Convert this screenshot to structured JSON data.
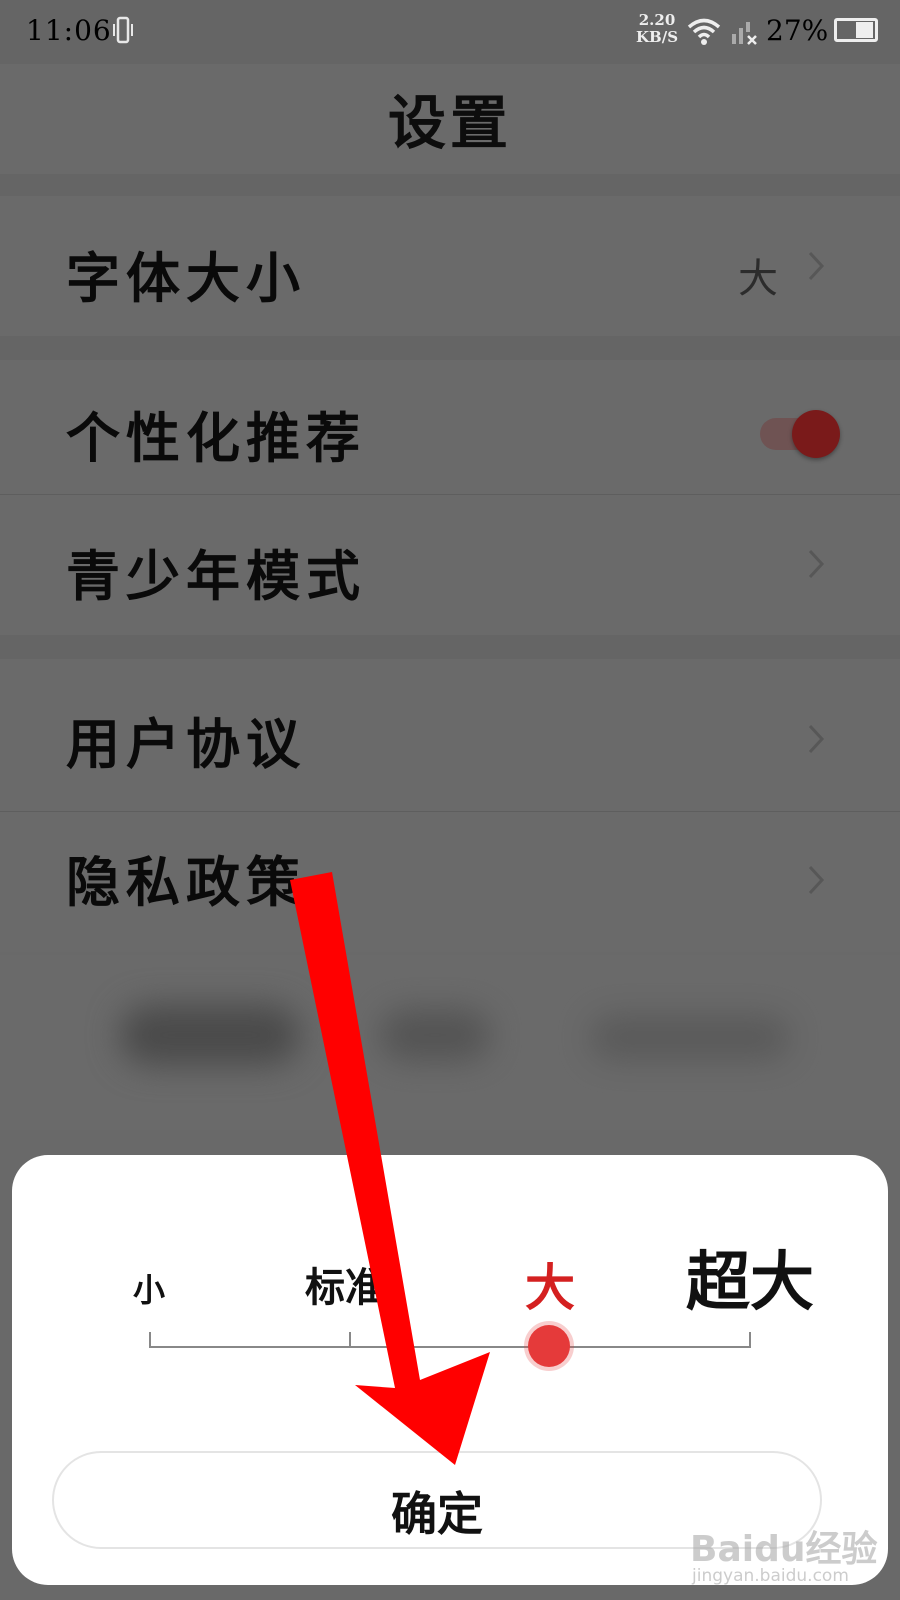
{
  "status_bar": {
    "time": "11:06",
    "net_speed_value": "2.20",
    "net_speed_unit": "KB/S",
    "battery": "27%"
  },
  "header": {
    "title": "设置"
  },
  "settings": {
    "font_size": {
      "label": "字体大小",
      "value": "大"
    },
    "personalized": {
      "label": "个性化推荐",
      "enabled": true
    },
    "teen_mode": {
      "label": "青少年模式"
    },
    "user_agreement": {
      "label": "用户协议"
    },
    "privacy_policy": {
      "label": "隐私政策"
    }
  },
  "font_dialog": {
    "options": [
      "小",
      "标准",
      "大",
      "超大"
    ],
    "selected": "大",
    "confirm_label": "确定"
  },
  "watermark": {
    "brand": "Baidu经验",
    "url": "jingyan.baidu.com"
  },
  "colors": {
    "accent": "#e53a3a",
    "arrow": "#ff0000",
    "overlay": "#696969"
  }
}
